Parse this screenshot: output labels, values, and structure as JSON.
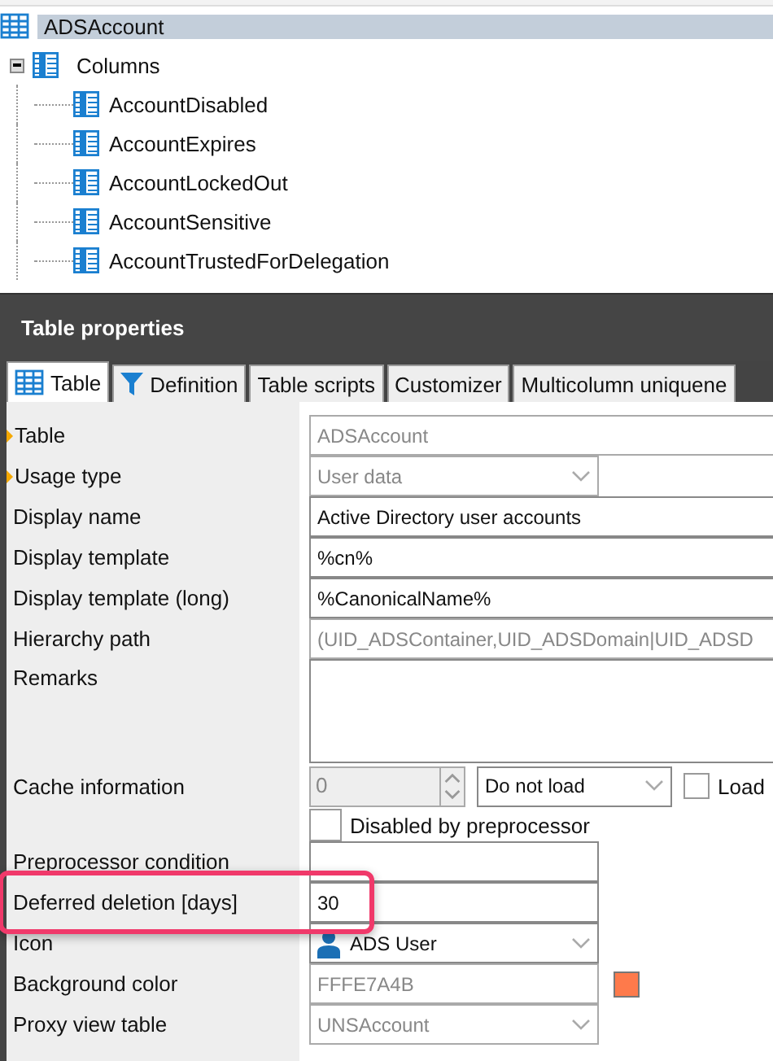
{
  "tree": {
    "root": {
      "label": "ADSAccount",
      "selected": true,
      "children": [
        {
          "label": "Columns",
          "expanded": true,
          "children": [
            {
              "label": "AccountDisabled"
            },
            {
              "label": "AccountExpires"
            },
            {
              "label": "AccountLockedOut"
            },
            {
              "label": "AccountSensitive"
            },
            {
              "label": "AccountTrustedForDelegation"
            }
          ]
        }
      ]
    }
  },
  "panel": {
    "title": "Table properties",
    "tabs": [
      {
        "label": "Table",
        "selected": true
      },
      {
        "label": "Definition",
        "selected": false
      },
      {
        "label": "Table scripts",
        "selected": false
      },
      {
        "label": "Customizer",
        "selected": false
      },
      {
        "label": "Multicolumn uniquene",
        "selected": false
      }
    ],
    "properties": [
      {
        "kind": "text",
        "label": "Table",
        "mandatory": true,
        "value": "ADSAccount",
        "disabled": true
      },
      {
        "kind": "combo",
        "label": "Usage type",
        "mandatory": true,
        "value": "User data",
        "disabled": true
      },
      {
        "kind": "text",
        "label": "Display name",
        "mandatory": false,
        "value": "Active Directory user accounts",
        "disabled": false
      },
      {
        "kind": "text",
        "label": "Display template",
        "mandatory": false,
        "value": "%cn%",
        "disabled": false
      },
      {
        "kind": "text",
        "label": "Display template (long)",
        "mandatory": false,
        "value": "%CanonicalName%",
        "disabled": false
      },
      {
        "kind": "text",
        "label": "Hierarchy path",
        "mandatory": false,
        "value": "(UID_ADSContainer,UID_ADSDomain|UID_ADSD",
        "disabled": true
      },
      {
        "kind": "memo",
        "label": "Remarks",
        "mandatory": false
      },
      {
        "kind": "cache",
        "label": "Cache information",
        "mandatory": false,
        "value": "0",
        "mode": "Do not load",
        "load_checked": false,
        "load_label": "Load"
      },
      {
        "kind": "checkbox",
        "value": "Disabled by preprocessor",
        "checked": false
      },
      {
        "kind": "short",
        "label": "Preprocessor condition",
        "mandatory": false
      },
      {
        "kind": "short",
        "label": "Deferred deletion [days]",
        "mandatory": false,
        "value": "30",
        "highlighted": true
      },
      {
        "kind": "icon",
        "label": "Icon",
        "mandatory": false,
        "value": "ADS User"
      },
      {
        "kind": "color",
        "label": "Background color",
        "mandatory": false,
        "value": "FFFE7A4B",
        "color": "#fe7a4b"
      },
      {
        "kind": "combo",
        "label": "Proxy view table",
        "mandatory": false,
        "value": "UNSAccount",
        "disabled": true
      }
    ]
  }
}
